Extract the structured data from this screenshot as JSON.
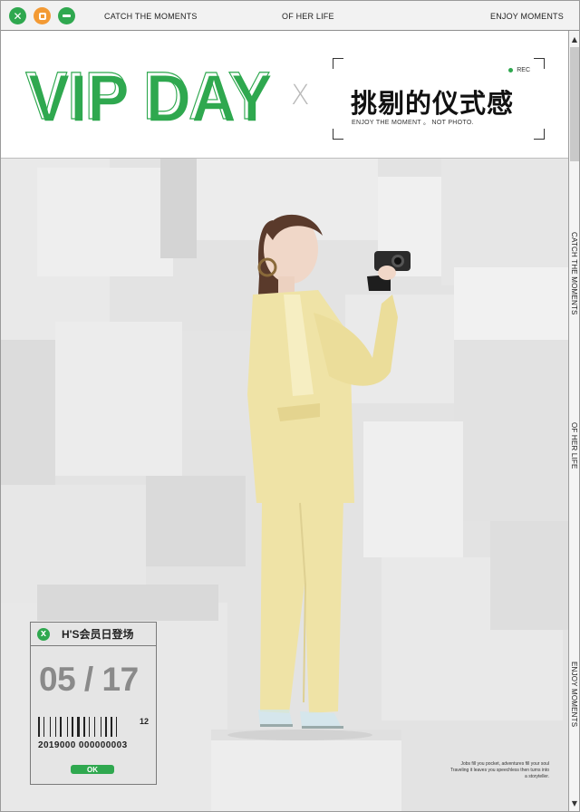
{
  "titlebar": {
    "text_left": "CATCH THE MOMENTS",
    "text_center": "OF HER LIFE",
    "text_right": "ENJOY MOMENTS"
  },
  "icons": {
    "close": "close-icon",
    "maximize": "maximize-icon",
    "minimize": "minimize-icon",
    "scroll_up": "scroll-up-icon",
    "scroll_down": "scroll-down-icon"
  },
  "banner": {
    "logo_text": "VIP DAY",
    "cross_symbol": "X",
    "rec_label": "REC",
    "title_cn": "挑剔的仪式感",
    "subtitle": "ENJOY THE MOMENT 。 NOT PHOTO."
  },
  "side_text": {
    "v1": "CATCH THE MOMENTS",
    "v2": "OF HER LIFE",
    "v3": "ENJOY MOMENTS"
  },
  "ticket": {
    "badge": "X",
    "title": "H'S会员日登场",
    "date": "05 / 17",
    "barcode_number": "12",
    "code": "2019000  000000003",
    "ok_label": "OK"
  },
  "caption": "Jobs fill you pocket, adventures fill your soul Traveling it leaves you speechless then turns into a storyteller.",
  "colors": {
    "accent_green": "#2fa84f",
    "accent_orange": "#f39a34",
    "suit_yellow": "#efe3a6"
  }
}
